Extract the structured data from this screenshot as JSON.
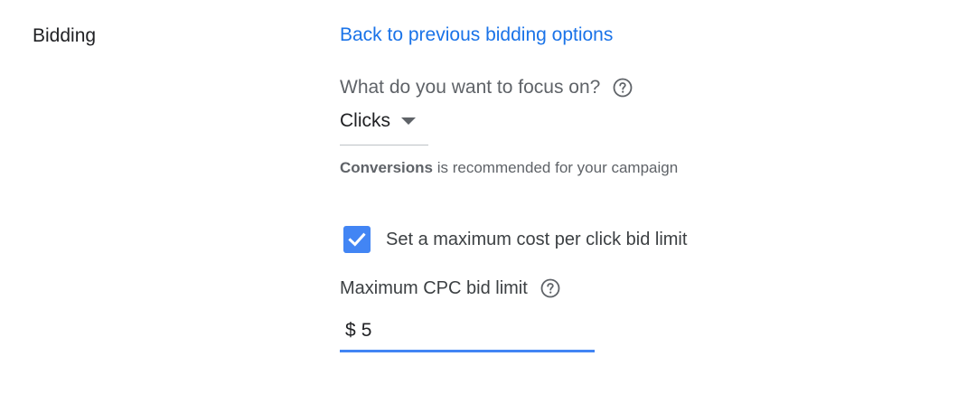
{
  "section": {
    "title": "Bidding"
  },
  "back_link": {
    "label": "Back to previous bidding options"
  },
  "focus": {
    "question": "What do you want to focus on?",
    "help_icon": "help-circle-icon",
    "selected": "Clicks",
    "dropdown_icon": "caret-down-icon"
  },
  "recommendation": {
    "highlight": "Conversions",
    "text": " is recommended for your campaign"
  },
  "max_cpc_toggle": {
    "label": "Set a maximum cost per click bid limit",
    "checked": true,
    "icon": "checkmark-icon"
  },
  "max_cpc": {
    "label": "Maximum CPC bid limit",
    "help_icon": "help-circle-icon",
    "currency": "$",
    "value": "5"
  },
  "colors": {
    "link": "#1a73e8",
    "accent": "#4285f4",
    "text": "#202124",
    "muted": "#5f6368"
  }
}
